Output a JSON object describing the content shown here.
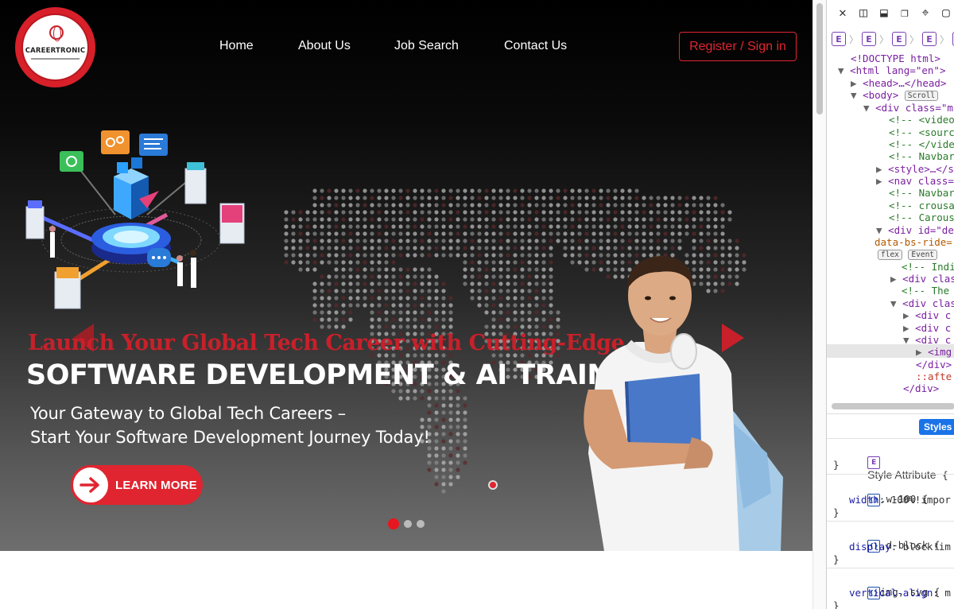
{
  "brand": {
    "logo_text": "CAREERTRONIC"
  },
  "nav": {
    "links": [
      "Home",
      "About Us",
      "Job Search",
      "Contact Us"
    ],
    "register_label": "Register / Sign in"
  },
  "hero": {
    "headline_top": "Launch Your Global Tech Career with Cutting-Edge",
    "headline_main": "SOFTWARE DEVELOPMENT & AI TRAINING",
    "subline_1": "Your Gateway to Global Tech Careers –",
    "subline_2": "Start Your Software Development Journey Today!",
    "cta_label": "LEARN MORE",
    "slides_total": 3,
    "active_slide": 1
  },
  "colors": {
    "accent": "#e02530",
    "hero_text": "#ffffff",
    "devtools_selection": "#e6e6e6",
    "styles_tab": "#1a73e8"
  },
  "devtools": {
    "toolbar_icons": [
      "close-icon",
      "dock-left-icon",
      "dock-bottom-icon",
      "undock-icon",
      "element-picker-icon",
      "device-icon"
    ],
    "breadcrumb_items": [
      "E",
      "E",
      "E",
      "E",
      "E"
    ],
    "dom_lines": [
      "<!DOCTYPE html>",
      "<html lang=\"en\">",
      "<head>…</head>",
      "<body>",
      "Scroll",
      "<div class=\"m",
      "<!-- <video",
      "<!-- <sourc",
      "<!-- </vide",
      "<!-- Navbar",
      "<style>…</s",
      "<nav class=",
      "<!-- Navbar",
      "<!-- crousa",
      "<!-- Carous",
      "<div id=\"de",
      "data-bs-ride=",
      "flex",
      "Event",
      "<!-- Indi",
      "<div clas",
      "<!-- The",
      "<div clas",
      "<div c",
      "<div c",
      "<div c",
      "<img",
      "</div>",
      "::afte",
      "</div>"
    ],
    "styles_tab_label": "Styles",
    "style_rules": [
      {
        "selector": "Style Attribute",
        "brace_open": "{",
        "brace_close": "}"
      },
      {
        "selector": ".w-100",
        "brace_open": "{",
        "property": "width",
        "value": "100%!impor",
        "brace_close": "}"
      },
      {
        "selector": ".d-block",
        "brace_open": "{",
        "property": "display",
        "value": "block!im",
        "brace_close": "}"
      },
      {
        "selector": "img, svg",
        "brace_open": "{",
        "property": "vertical-align",
        "value": "m",
        "brace_close": "}"
      }
    ]
  }
}
